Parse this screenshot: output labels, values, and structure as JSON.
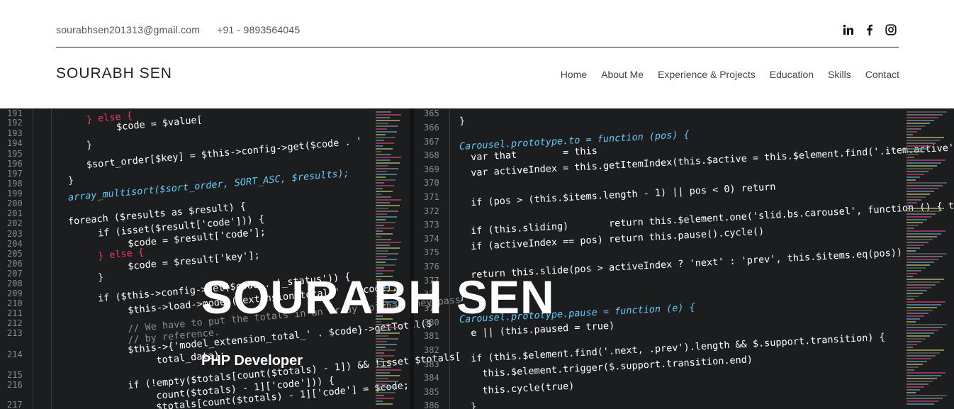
{
  "header": {
    "email": "sourabhsen201313@gmail.com",
    "phone": "+91 - 9893564045",
    "brand": "SOURABH SEN",
    "social": [
      "linkedin-icon",
      "facebook-icon",
      "instagram-icon"
    ],
    "nav": [
      "Home",
      "About Me",
      "Experience & Projects",
      "Education",
      "Skills",
      "Contact"
    ]
  },
  "hero": {
    "title": "SOURABH SEN",
    "subtitle": "PHP Developer"
  },
  "code_left": {
    "line_numbers": [
      "191",
      "192",
      "193",
      "194",
      "195",
      "196",
      "197",
      "198",
      "199",
      "200",
      "201",
      "202",
      "203",
      "204",
      "205",
      "206",
      "207",
      "208",
      "209",
      "210",
      "211",
      "212",
      "213",
      "214",
      "215",
      "216",
      "217"
    ],
    "lines": [
      "} else {",
      "  $code = $value[",
      "}",
      "$sort_order[$key] = $this->config->get($code . '",
      "}",
      "array_multisort($sort_order, SORT_ASC, $results);",
      "foreach ($results as $result) {",
      "  if (isset($result['code'])) {",
      "    $code = $result['code'];",
      "  } else {",
      "    $code = $result['key'];",
      "  }",
      "  if ($this->config->get($code . '_status')) {",
      "    $this->load->model('extension/total/' . $code);",
      "    // We have to put the totals in an array so that they pass",
      "    // by reference.",
      "    $this->{'model_extension_total_' . $code}->getTotal($",
      "      total_data);",
      "    if (!empty($totals[count($totals) - 1]) && !isset($totals[",
      "      count($totals) - 1]['code'])) {",
      "      $totals[count($totals) - 1]['code'] = $code;"
    ]
  },
  "code_right": {
    "line_numbers": [
      "365",
      "366",
      "367",
      "368",
      "369",
      "370",
      "371",
      "372",
      "373",
      "374",
      "375",
      "376",
      "377",
      "378",
      "379",
      "380",
      "381",
      "382",
      "383",
      "384",
      "385",
      "386"
    ],
    "lines": [
      "}",
      "Carousel.prototype.to = function (pos) {",
      "  var that        = this",
      "  var activeIndex = this.getItemIndex(this.$active = this.$element.find('.item.active'))",
      "  if (pos > (this.$items.length - 1) || pos < 0) return",
      "  if (this.sliding)       return this.$element.one('slid.bs.carousel', function () { that.to(pos) })",
      "  if (activeIndex == pos) return this.pause().cycle()",
      "  return this.slide(pos > activeIndex ? 'next' : 'prev', this.$items.eq(pos))",
      "}",
      "Carousel.prototype.pause = function (e) {",
      "  e || (this.paused = true)",
      "  if (this.$element.find('.next, .prev').length && $.support.transition) {",
      "    this.$element.trigger($.support.transition.end)",
      "    this.cycle(true)",
      "  }"
    ]
  }
}
